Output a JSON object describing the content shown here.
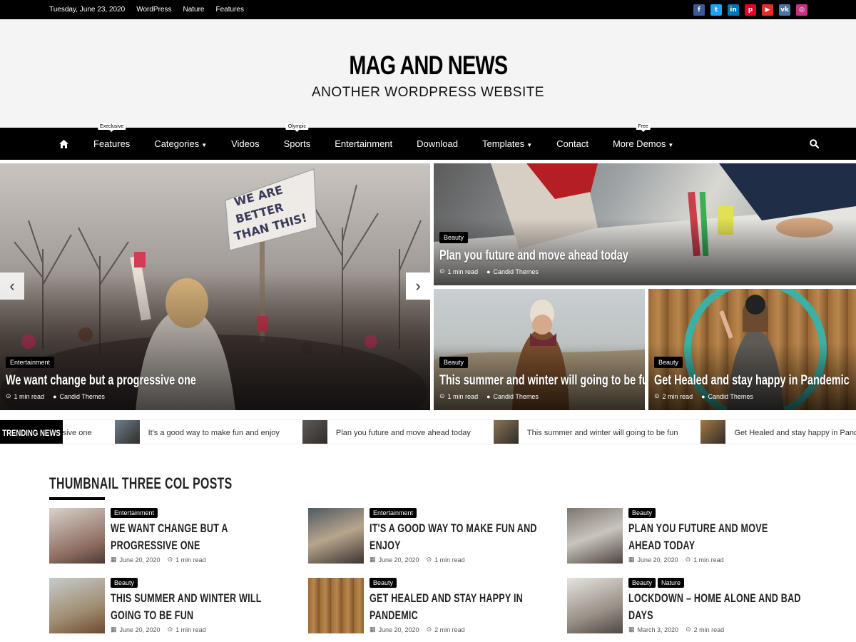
{
  "topbar": {
    "date": "Tuesday, June 23, 2020",
    "links": [
      "WordPress",
      "Nature",
      "Features"
    ],
    "social": [
      {
        "name": "facebook-icon",
        "glyph": "f",
        "color": "#3b5998"
      },
      {
        "name": "twitter-icon",
        "glyph": "t",
        "color": "#1da1f2"
      },
      {
        "name": "linkedin-icon",
        "glyph": "in",
        "color": "#0077b5"
      },
      {
        "name": "pinterest-icon",
        "glyph": "p",
        "color": "#e60023"
      },
      {
        "name": "youtube-icon",
        "glyph": "▶",
        "color": "#e52d27"
      },
      {
        "name": "vk-icon",
        "glyph": "vk",
        "color": "#4c75a3"
      },
      {
        "name": "instagram-icon",
        "glyph": "◎",
        "color": "#c13584"
      }
    ]
  },
  "header": {
    "title": "MAG AND NEWS",
    "tagline": "ANOTHER WORDPRESS WEBSITE"
  },
  "nav": {
    "items": [
      {
        "label": "Features",
        "badge": "Execlusive",
        "caret": false
      },
      {
        "label": "Categories",
        "badge": "",
        "caret": true
      },
      {
        "label": "Videos",
        "badge": "",
        "caret": false
      },
      {
        "label": "Sports",
        "badge": "Olympic",
        "caret": false
      },
      {
        "label": "Entertainment",
        "badge": "",
        "caret": false
      },
      {
        "label": "Download",
        "badge": "",
        "caret": false
      },
      {
        "label": "Templates",
        "badge": "",
        "caret": true
      },
      {
        "label": "Contact",
        "badge": "",
        "caret": false
      },
      {
        "label": "More Demos",
        "badge": "Free",
        "caret": true
      }
    ]
  },
  "hero": {
    "main": {
      "category": "Entertainment",
      "title": "We want change but a progressive one",
      "read": "1 min read",
      "author": "Candid Themes"
    },
    "top_right": {
      "category": "Beauty",
      "title": "Plan you future and move ahead today",
      "read": "1 min read",
      "author": "Candid Themes"
    },
    "bottom_left": {
      "category": "Beauty",
      "title": "This summer and winter will going to be fun",
      "read": "1 min read",
      "author": "Candid Themes"
    },
    "bottom_right": {
      "category": "Beauty",
      "title": "Get Healed and stay happy in Pandemic",
      "read": "2 min read",
      "author": "Candid Themes"
    }
  },
  "ticker": {
    "label": "TRENDING NEWS",
    "items": [
      "We want change but a progressive one",
      "It's a good way to make fun and enjoy",
      "Plan you future and move ahead today",
      "This summer and winter will going to be fun",
      "Get Healed and stay happy in Pandemic"
    ]
  },
  "section": {
    "title": "THUMBNAIL THREE COL POSTS",
    "posts": [
      {
        "tags": [
          "Entertainment"
        ],
        "title": "WE WANT CHANGE BUT A PROGRESSIVE ONE",
        "date": "June 20, 2020",
        "read": "1 min read"
      },
      {
        "tags": [
          "Entertainment"
        ],
        "title": "IT'S A GOOD WAY TO MAKE FUN AND ENJOY",
        "date": "June 20, 2020",
        "read": "1 min read"
      },
      {
        "tags": [
          "Beauty"
        ],
        "title": "PLAN YOU FUTURE AND MOVE AHEAD TODAY",
        "date": "June 20, 2020",
        "read": "1 min read"
      },
      {
        "tags": [
          "Beauty"
        ],
        "title": "THIS SUMMER AND WINTER WILL GOING TO BE FUN",
        "date": "June 20, 2020",
        "read": "1 min read"
      },
      {
        "tags": [
          "Beauty"
        ],
        "title": "GET HEALED AND STAY HAPPY IN PANDEMIC",
        "date": "June 20, 2020",
        "read": "2 min read"
      },
      {
        "tags": [
          "Beauty",
          "Nature"
        ],
        "title": "LOCKDOWN – HOME ALONE AND BAD DAYS",
        "date": "March 3, 2020",
        "read": "2 min read"
      }
    ]
  }
}
